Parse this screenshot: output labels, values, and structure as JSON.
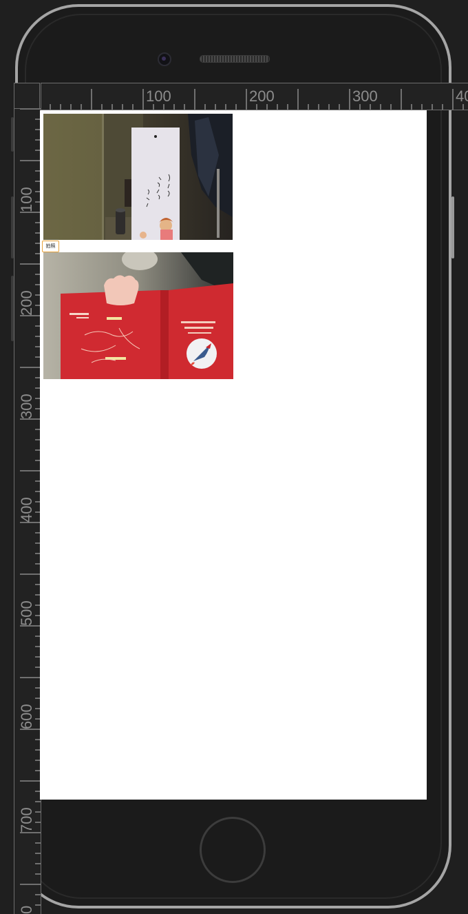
{
  "simulator": {
    "ruler_top_labels": [
      "100",
      "200",
      "300",
      "40"
    ],
    "ruler_left_labels": [
      "100",
      "200",
      "300",
      "400",
      "500",
      "600",
      "700",
      "0"
    ]
  },
  "page": {
    "shoot_button_label": "拍照"
  },
  "colors": {
    "button_border": "#e8a23a",
    "book_red": "#c8252c",
    "screen_bg": "#ffffff",
    "device_frame": "#a5a5a5"
  }
}
